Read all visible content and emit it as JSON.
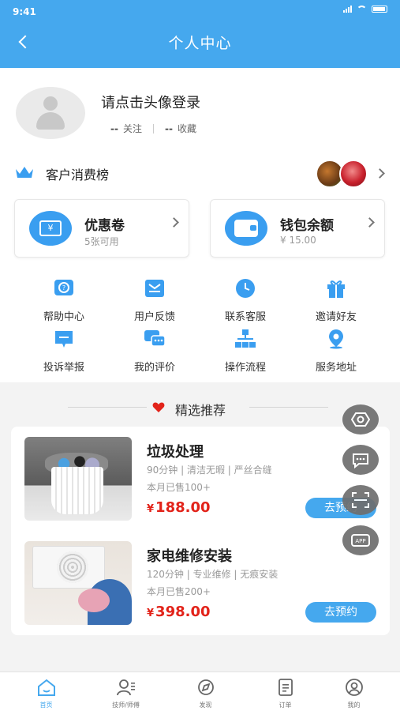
{
  "status_bar": {
    "time": "9:41"
  },
  "header": {
    "title": "个人中心",
    "back_icon": "chevron-left-icon"
  },
  "profile": {
    "login_prompt": "请点击头像登录",
    "follow_count": "--",
    "follow_label": "关注",
    "favorite_count": "--",
    "favorite_label": "收藏"
  },
  "ranking": {
    "label": "客户消费榜",
    "icon": "crown-icon"
  },
  "cards": [
    {
      "title": "优惠卷",
      "subtitle": "5张可用",
      "icon": "coupon-icon",
      "icon_text": "¥"
    },
    {
      "title": "钱包余额",
      "subtitle": "¥ 15.00",
      "icon": "wallet-icon"
    }
  ],
  "shortcuts": [
    {
      "label": "帮助中心",
      "icon": "help-icon"
    },
    {
      "label": "用户反馈",
      "icon": "feedback-icon"
    },
    {
      "label": "联系客服",
      "icon": "clock-icon"
    },
    {
      "label": "邀请好友",
      "icon": "gift-icon"
    },
    {
      "label": "投诉举报",
      "icon": "report-icon"
    },
    {
      "label": "我的评价",
      "icon": "chat-icon"
    },
    {
      "label": "操作流程",
      "icon": "flowchart-icon"
    },
    {
      "label": "服务地址",
      "icon": "location-icon"
    }
  ],
  "recommend": {
    "title": "精选推荐",
    "items": [
      {
        "name": "垃圾处理",
        "desc": "90分钟 | 清洁无暇 | 严丝合缝",
        "sold": "本月已售100+",
        "currency": "¥",
        "price": "188.00",
        "button": "去预约"
      },
      {
        "name": "家电维修安装",
        "desc": "120分钟 | 专业维修 | 无痕安装",
        "sold": "本月已售200+",
        "currency": "¥",
        "price": "398.00",
        "button": "去预约"
      }
    ]
  },
  "floating": [
    "settings-icon",
    "message-icon",
    "scan-icon",
    "app-icon"
  ],
  "floating_app_text": "APP",
  "tabbar": [
    {
      "label": "首页",
      "icon": "home-icon",
      "active": true
    },
    {
      "label": "技师/师傅",
      "icon": "technician-icon",
      "active": false
    },
    {
      "label": "发现",
      "icon": "discover-icon",
      "active": false
    },
    {
      "label": "订单",
      "icon": "order-icon",
      "active": false
    },
    {
      "label": "我的",
      "icon": "profile-icon",
      "active": false
    }
  ],
  "colors": {
    "primary": "#45a8ee",
    "price": "#e2231a",
    "heart": "#e2231a"
  }
}
